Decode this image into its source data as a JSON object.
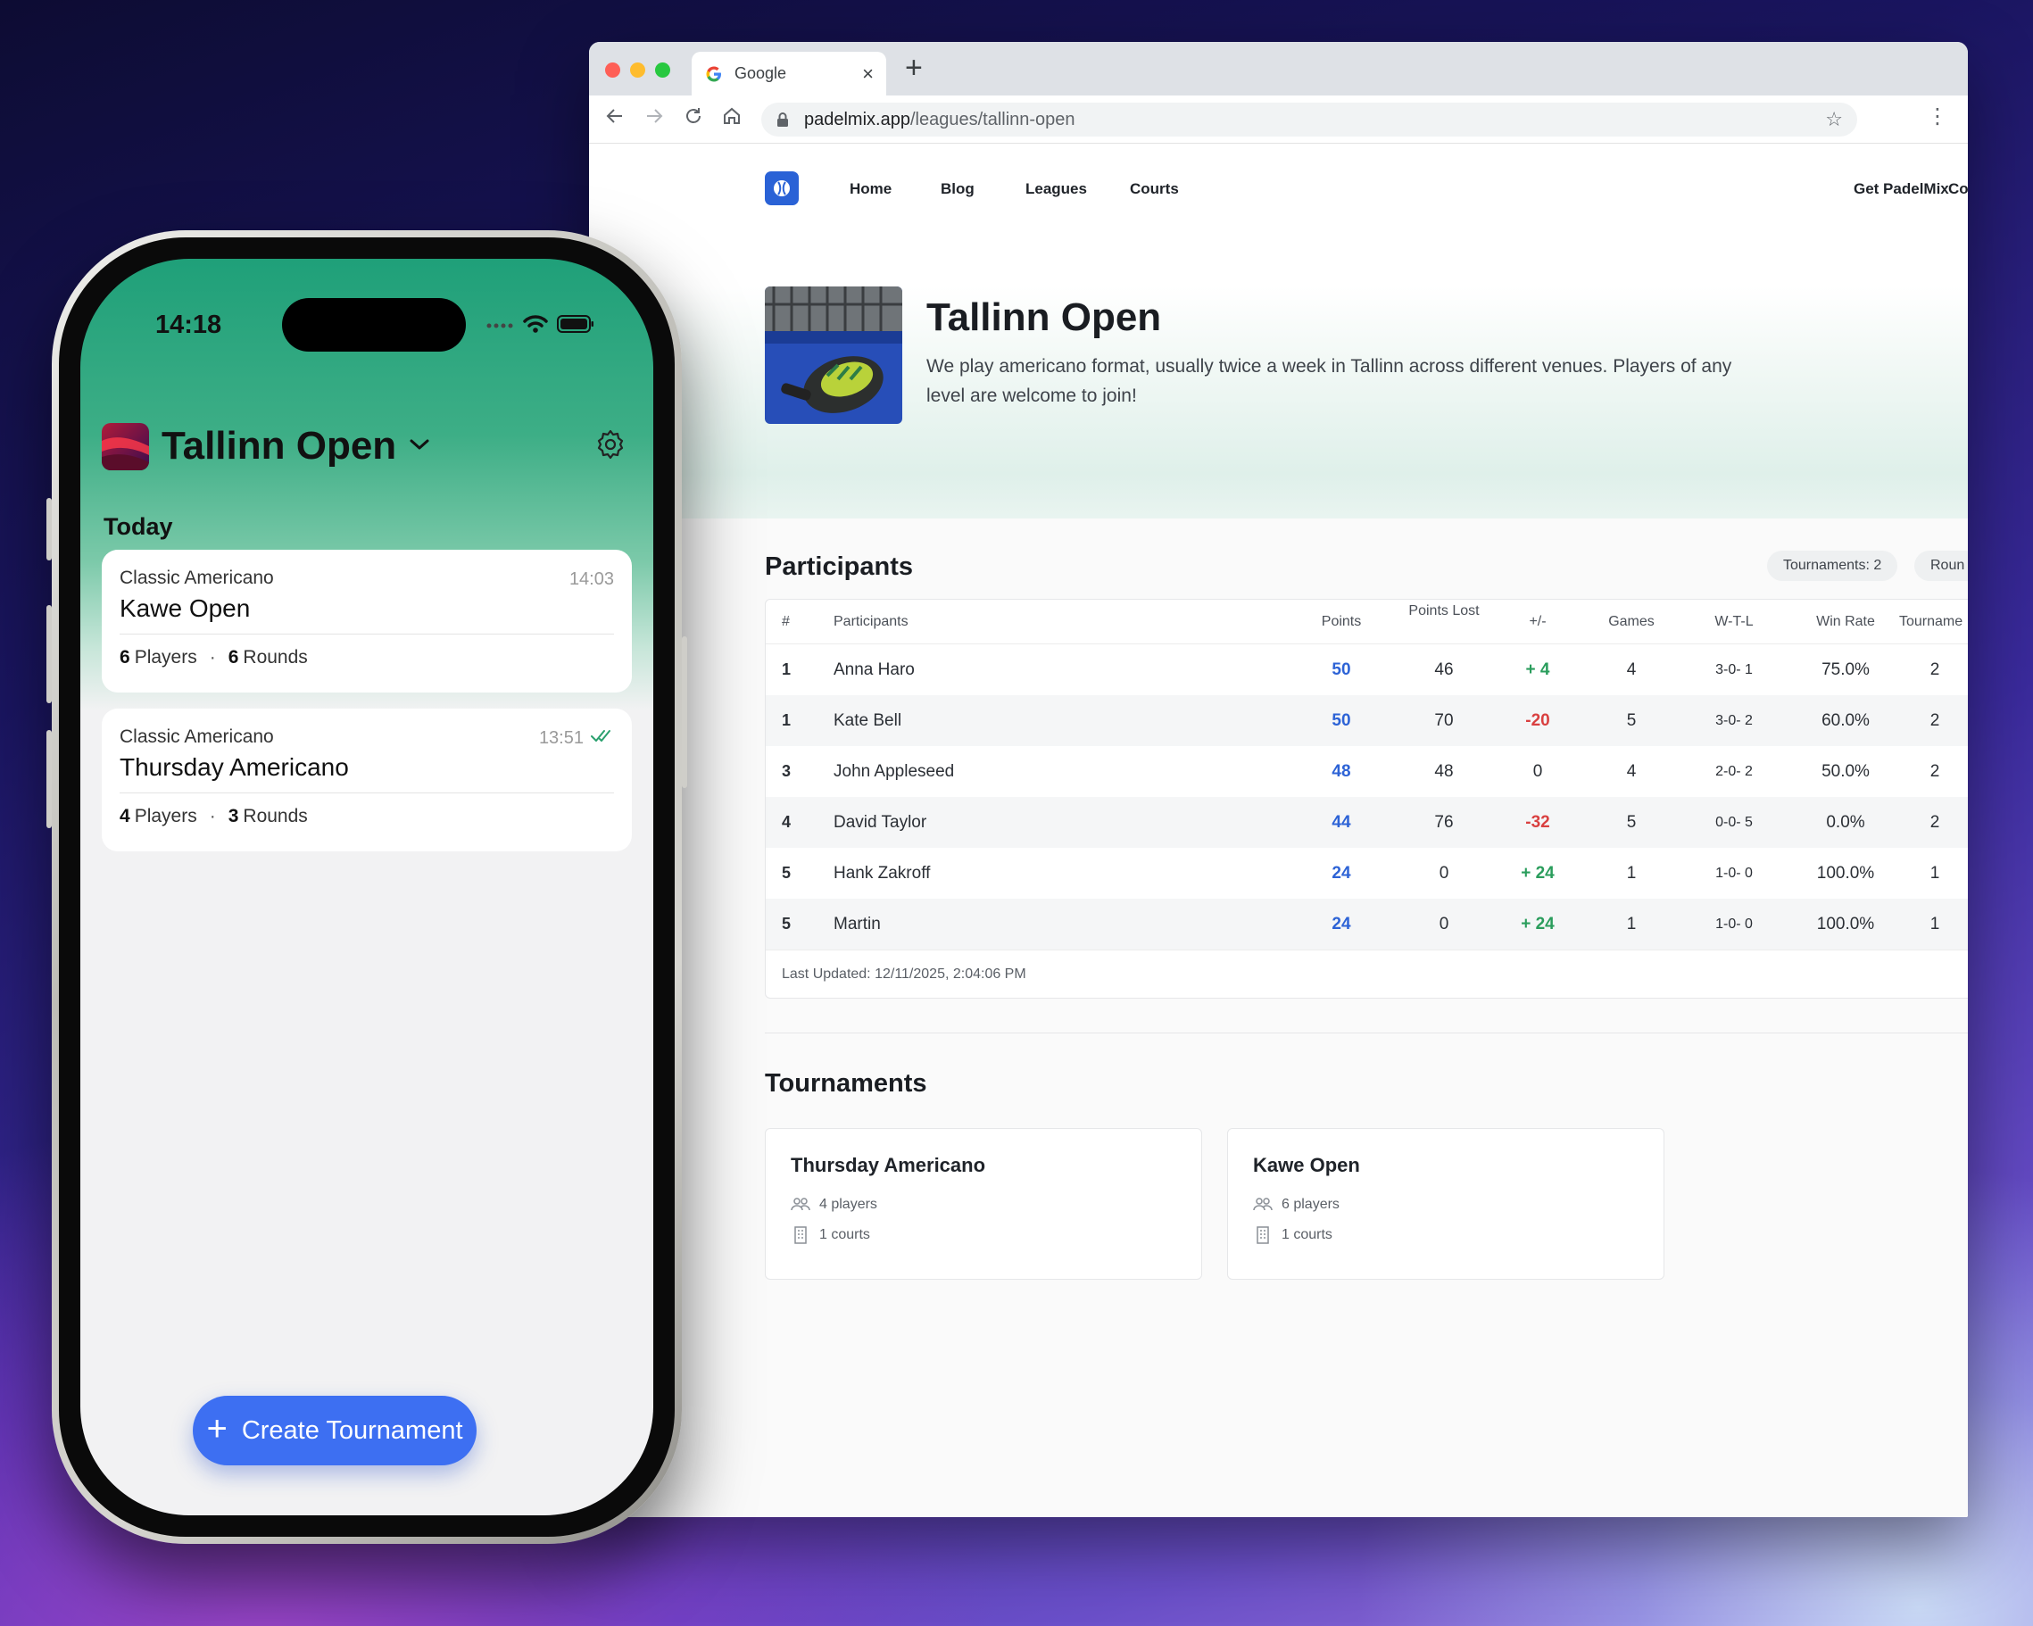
{
  "browser": {
    "tab_title": "Google",
    "tab_close": "×",
    "new_tab": "+",
    "url_host": "padelmix.app",
    "url_path": "/leagues/tallinn-open"
  },
  "site": {
    "nav": {
      "home": "Home",
      "blog": "Blog",
      "leagues": "Leagues",
      "courts": "Courts",
      "get": "Get PadelMix",
      "cut": "Co"
    },
    "league": {
      "title": "Tallinn Open",
      "description": "We play americano format, usually twice a week in Tallinn across different venues. Players of any level are welcome to join!"
    },
    "participants": {
      "title": "Participants",
      "pill_tournaments": "Tournaments: 2",
      "pill_rounds": "Roun",
      "columns": {
        "rank": "#",
        "name": "Participants",
        "points": "Points",
        "lost": "Points Lost",
        "diff": "+/-",
        "games": "Games",
        "wtl": "W-T-L",
        "winrate": "Win Rate",
        "tournaments": "Tourname"
      },
      "rows": [
        {
          "rank": "1",
          "name": "Anna Haro",
          "points": "50",
          "lost": "46",
          "diff": "+ 4",
          "games": "4",
          "wtl": "3-0- 1",
          "winrate": "75.0%",
          "tournaments": "2"
        },
        {
          "rank": "1",
          "name": "Kate Bell",
          "points": "50",
          "lost": "70",
          "diff": "-20",
          "games": "5",
          "wtl": "3-0- 2",
          "winrate": "60.0%",
          "tournaments": "2"
        },
        {
          "rank": "3",
          "name": "John Appleseed",
          "points": "48",
          "lost": "48",
          "diff": "0",
          "games": "4",
          "wtl": "2-0- 2",
          "winrate": "50.0%",
          "tournaments": "2"
        },
        {
          "rank": "4",
          "name": "David Taylor",
          "points": "44",
          "lost": "76",
          "diff": "-32",
          "games": "5",
          "wtl": "0-0- 5",
          "winrate": "0.0%",
          "tournaments": "2"
        },
        {
          "rank": "5",
          "name": "Hank Zakroff",
          "points": "24",
          "lost": "0",
          "diff": "+ 24",
          "games": "1",
          "wtl": "1-0- 0",
          "winrate": "100.0%",
          "tournaments": "1"
        },
        {
          "rank": "5",
          "name": "Martin",
          "points": "24",
          "lost": "0",
          "diff": "+ 24",
          "games": "1",
          "wtl": "1-0- 0",
          "winrate": "100.0%",
          "tournaments": "1"
        }
      ],
      "last_updated": "Last Updated: 12/11/2025, 2:04:06 PM"
    },
    "tournaments": {
      "title": "Tournaments",
      "items": [
        {
          "name": "Thursday Americano",
          "players": "4 players",
          "courts": "1 courts"
        },
        {
          "name": "Kawe Open",
          "players": "6 players",
          "courts": "1 courts"
        }
      ]
    }
  },
  "phone": {
    "time": "14:18",
    "league_title": "Tallinn Open",
    "section": "Today",
    "cards": [
      {
        "type": "Classic Americano",
        "time": "14:03",
        "name": "Kawe Open",
        "players_num": "6",
        "players_label": "Players",
        "rounds_num": "6",
        "rounds_label": "Rounds"
      },
      {
        "type": "Classic Americano",
        "time": "13:51",
        "name": "Thursday Americano",
        "players_num": "4",
        "players_label": "Players",
        "rounds_num": "3",
        "rounds_label": "Rounds"
      }
    ],
    "dot": "·",
    "create_button": "Create Tournament"
  },
  "colors": {
    "accent_blue": "#2d63d6",
    "positive": "#2a9d5c",
    "negative": "#d94040",
    "phone_button": "#3d6ff2",
    "phone_header_green": "#1fa079"
  }
}
